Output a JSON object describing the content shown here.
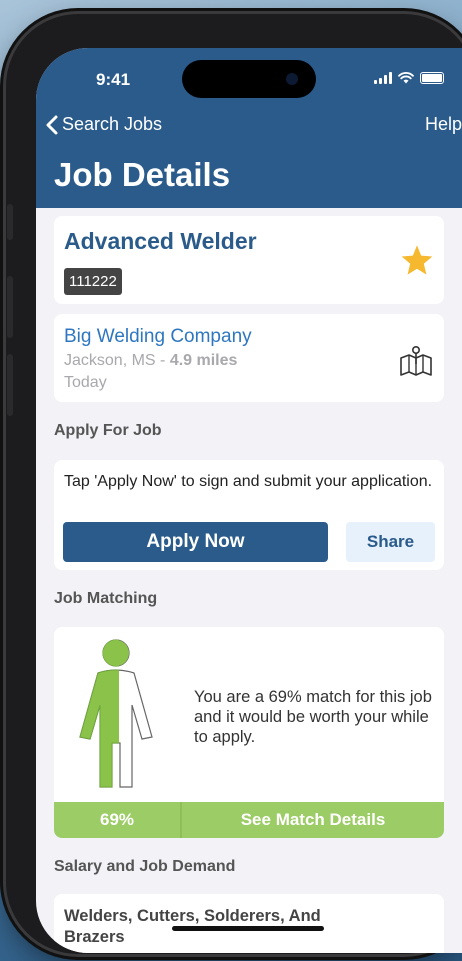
{
  "status_bar": {
    "time": "9:41"
  },
  "nav": {
    "back_label": "Search Jobs",
    "help_label": "Help",
    "title": "Job Details"
  },
  "job": {
    "title": "Advanced Welder",
    "id": "111222",
    "favorite": true,
    "star_color": "#f5b82e"
  },
  "employer": {
    "company": "Big Welding Company",
    "location": "Jackson, MS - ",
    "distance": "4.9 miles",
    "posted": "Today"
  },
  "apply": {
    "section_label": "Apply For Job",
    "instructions": "Tap 'Apply Now' to sign and submit your application.",
    "apply_label": "Apply Now",
    "share_label": "Share"
  },
  "matching": {
    "section_label": "Job Matching",
    "message": "You are a 69% match for this job and it would be worth your while to apply.",
    "percent_label": "69%",
    "match_fraction": 0.69,
    "details_label": "See Match Details",
    "accent": "#9ccc65"
  },
  "salary": {
    "section_label": "Salary and Job Demand",
    "occupation": "Welders, Cutters, Solderers, And Brazers"
  },
  "colors": {
    "header": "#2a5b8b",
    "link": "#2e77c0",
    "background": "#f2f2f7"
  }
}
